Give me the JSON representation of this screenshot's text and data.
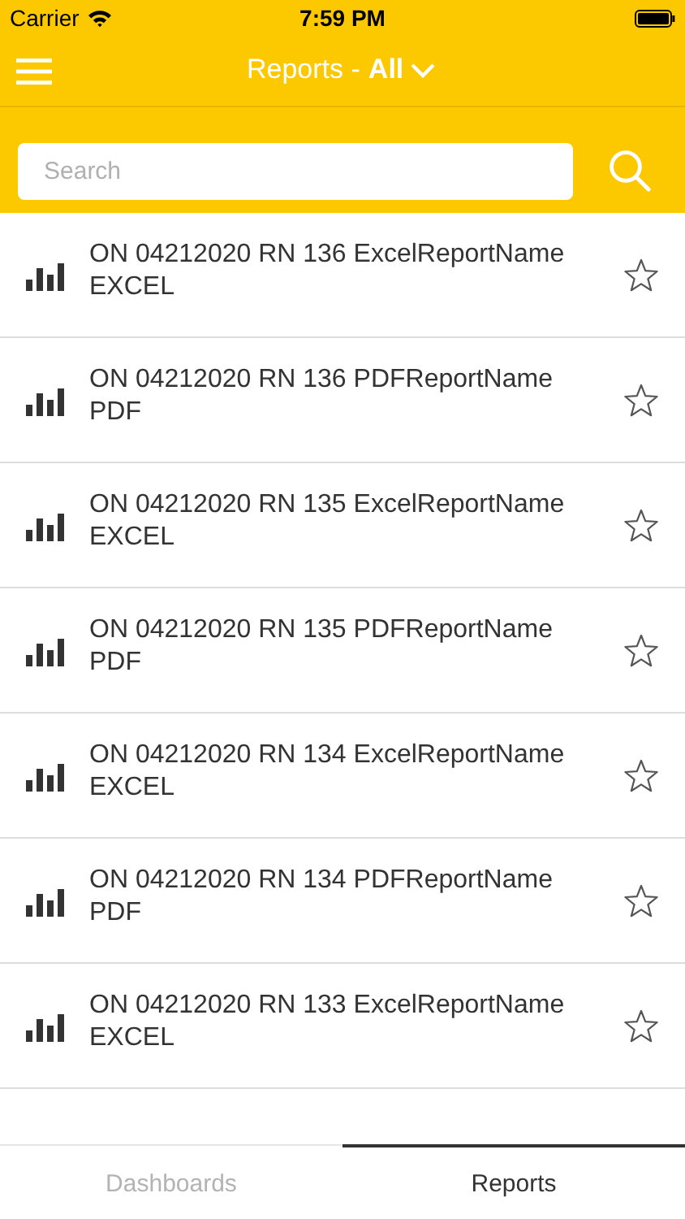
{
  "status_bar": {
    "carrier": "Carrier",
    "time": "7:59 PM"
  },
  "header": {
    "title": "Reports - ",
    "filter": "All"
  },
  "search": {
    "placeholder": "Search"
  },
  "reports": [
    {
      "name": "ON 04212020 RN 136 ExcelReportName",
      "format": "EXCEL",
      "favorite": false
    },
    {
      "name": "ON 04212020 RN 136 PDFReportName",
      "format": "PDF",
      "favorite": false
    },
    {
      "name": "ON 04212020 RN 135 ExcelReportName",
      "format": "EXCEL",
      "favorite": false
    },
    {
      "name": "ON 04212020 RN 135 PDFReportName",
      "format": "PDF",
      "favorite": false
    },
    {
      "name": "ON 04212020 RN 134 ExcelReportName",
      "format": "EXCEL",
      "favorite": false
    },
    {
      "name": "ON 04212020 RN 134 PDFReportName",
      "format": "PDF",
      "favorite": false
    },
    {
      "name": "ON 04212020 RN 133 ExcelReportName",
      "format": "EXCEL",
      "favorite": false
    }
  ],
  "tabs": [
    {
      "label": "Dashboards",
      "selected": false
    },
    {
      "label": "Reports",
      "selected": true
    }
  ]
}
